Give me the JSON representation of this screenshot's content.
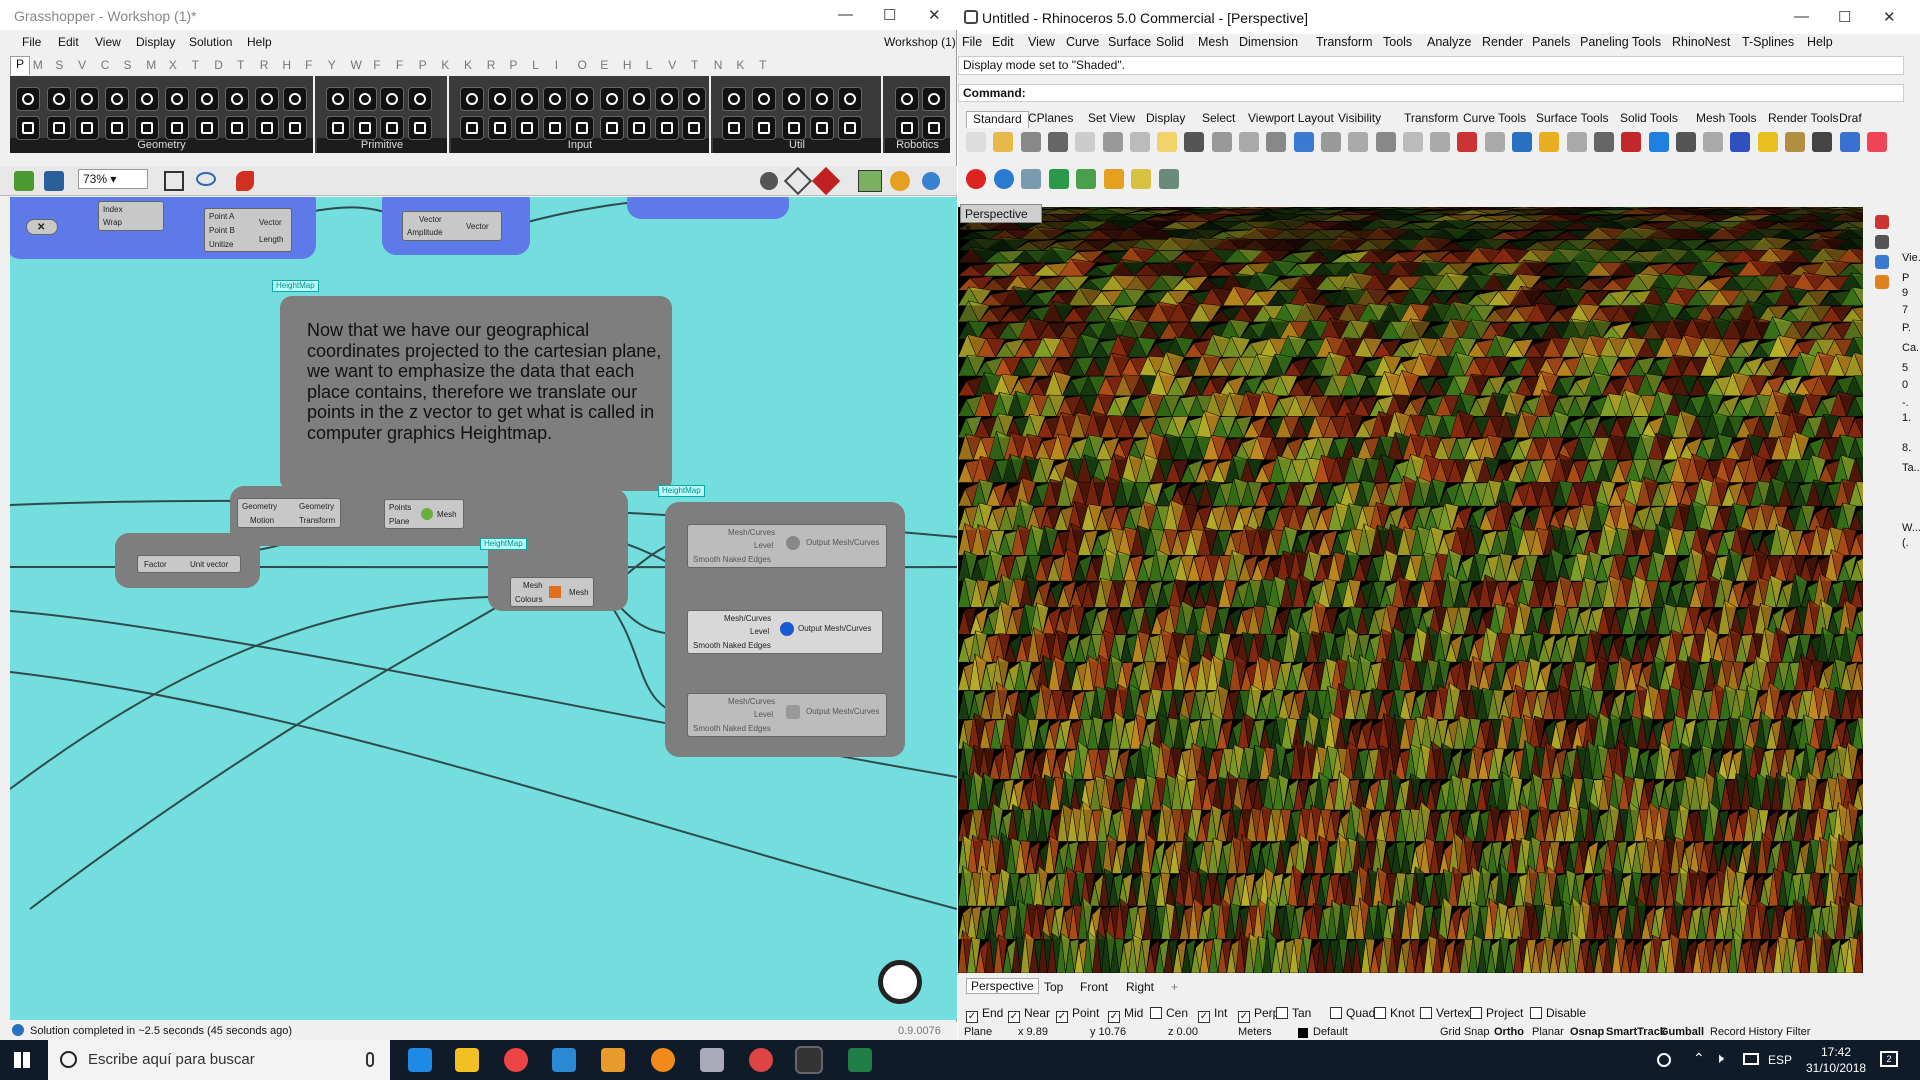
{
  "grasshopper": {
    "window_title": "Grasshopper - Workshop (1)*",
    "doc_name": "Workshop (1)",
    "menu": [
      "File",
      "Edit",
      "View",
      "Display",
      "Solution",
      "Help"
    ],
    "tabs": [
      "P",
      "M",
      "S",
      "V",
      "C",
      "S",
      "M",
      "X",
      "T",
      "D",
      "T",
      "R",
      "H",
      "F",
      "Y",
      "W",
      "F",
      "F",
      "P",
      "K",
      "K",
      "R",
      "P",
      "L",
      "I",
      "O",
      "E",
      "H",
      "L",
      "V",
      "T",
      "N",
      "K",
      "T"
    ],
    "ribbon_groups": [
      "Geometry",
      "Primitive",
      "Input",
      "Util",
      "Robotics"
    ],
    "zoom": "73%",
    "note_text": "Now that we have our geographical coordinates projected to the cartesian plane, we want to emphasize the data that each place contains, therefore we translate our points in the z vector to get what is called in computer graphics Heightmap.",
    "tags": [
      "HeightMap",
      "HeightMap",
      "HeightMap"
    ],
    "nodes": {
      "index_wrap": {
        "in": [
          "Index",
          "Wrap"
        ]
      },
      "vector2pt": {
        "in": [
          "Point A",
          "Point B",
          "Unitize"
        ],
        "out": [
          "Vector",
          "Length"
        ]
      },
      "amplitude": {
        "in": [
          "Vector",
          "Amplitude"
        ],
        "out": [
          "Vector"
        ]
      },
      "move": {
        "in": [
          "Geometry",
          "Motion"
        ],
        "out": [
          "Geometry",
          "Transform"
        ]
      },
      "delaunay": {
        "in": [
          "Points",
          "Plane"
        ],
        "out": [
          "Mesh"
        ]
      },
      "unitz": {
        "in": [
          "Factor"
        ],
        "out": [
          "Unit vector"
        ]
      },
      "meshcolour": {
        "in": [
          "Mesh",
          "Colours"
        ],
        "out": [
          "Mesh"
        ]
      },
      "preview1": {
        "title": "Mesh/Curves",
        "level": "Level",
        "out": "Output Mesh/Curves",
        "smooth": "Smooth Naked Edges"
      },
      "preview2": {
        "title": "Mesh/Curves",
        "level": "Level",
        "out": "Output Mesh/Curves",
        "smooth": "Smooth Naked Edges"
      },
      "preview3": {
        "title": "Mesh/Curves",
        "level": "Level",
        "out": "Output Mesh/Curves",
        "smooth": "Smooth Naked Edges"
      }
    },
    "status": "Solution completed in ~2.5 seconds (45 seconds ago)",
    "version": "0.9.0076"
  },
  "rhino": {
    "window_title": "Untitled - Rhinoceros 5.0 Commercial - [Perspective]",
    "menu": [
      "File",
      "Edit",
      "View",
      "Curve",
      "Surface",
      "Solid",
      "Mesh",
      "Dimension",
      "Transform",
      "Tools",
      "Analyze",
      "Render",
      "Panels",
      "Paneling Tools",
      "RhinoNest",
      "T-Splines",
      "Help"
    ],
    "history": "Display mode set to \"Shaded\".",
    "command_label": "Command:",
    "toolbar_tabs": [
      "Standard",
      "CPlanes",
      "Set View",
      "Display",
      "Select",
      "Viewport Layout",
      "Visibility",
      "Transform",
      "Curve Tools",
      "Surface Tools",
      "Solid Tools",
      "Mesh Tools",
      "Render Tools",
      "Draf"
    ],
    "viewport_label": "Perspective",
    "viewport_tabs": [
      "Perspective",
      "Top",
      "Front",
      "Right"
    ],
    "side_panel": [
      "Vie...",
      "P",
      "9",
      "7",
      "P.",
      "Ca...",
      "5",
      "0",
      "-.",
      "1.",
      "8.",
      "Ta...",
      "W...",
      "(."
    ],
    "osnaps": [
      {
        "label": "End",
        "checked": true
      },
      {
        "label": "Near",
        "checked": true
      },
      {
        "label": "Point",
        "checked": true
      },
      {
        "label": "Mid",
        "checked": true
      },
      {
        "label": "Cen",
        "checked": false
      },
      {
        "label": "Int",
        "checked": true
      },
      {
        "label": "Perp",
        "checked": true
      },
      {
        "label": "Tan",
        "checked": false
      },
      {
        "label": "Quad",
        "checked": false
      },
      {
        "label": "Knot",
        "checked": false
      },
      {
        "label": "Vertex",
        "checked": false
      },
      {
        "label": "Project",
        "checked": false
      },
      {
        "label": "Disable",
        "checked": false
      }
    ],
    "status": {
      "cplane": "Plane",
      "x": "x 9.89",
      "y": "y 10.76",
      "z": "z 0.00",
      "units": "Meters",
      "layer": "Default",
      "toggles": [
        "Grid Snap",
        "Ortho",
        "Planar",
        "Osnap",
        "SmartTrack",
        "Gumball",
        "Record History",
        "Filter"
      ]
    }
  },
  "taskbar": {
    "search_placeholder": "Escribe aquí para buscar",
    "language": "ESP",
    "time": "17:42",
    "date": "31/10/2018",
    "notifications": "2"
  }
}
